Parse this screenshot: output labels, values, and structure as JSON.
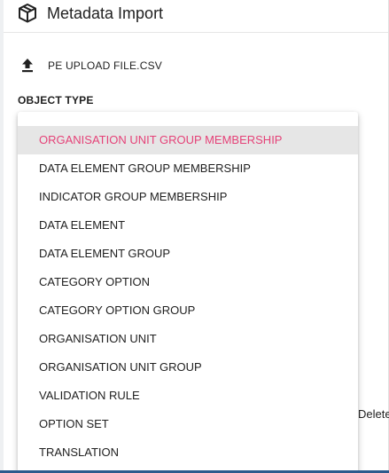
{
  "header": {
    "title": "Metadata Import",
    "icon": "box-import-icon"
  },
  "upload": {
    "label": "PE UPLOAD FILE.CSV",
    "icon": "upload-icon"
  },
  "object_type": {
    "label": "OBJECT TYPE",
    "selected": "ORGANISATION UNIT GROUP MEMBERSHIP",
    "options": [
      "ORGANISATION UNIT GROUP MEMBERSHIP",
      "DATA ELEMENT GROUP MEMBERSHIP",
      "INDICATOR GROUP MEMBERSHIP",
      "DATA ELEMENT",
      "DATA ELEMENT GROUP",
      "CATEGORY OPTION",
      "CATEGORY OPTION GROUP",
      "ORGANISATION UNIT",
      "ORGANISATION UNIT GROUP",
      "VALIDATION RULE",
      "OPTION SET",
      "TRANSLATION"
    ]
  },
  "background_text": {
    "partial": "Delete"
  },
  "colors": {
    "accent": "#e54278",
    "selected_bg": "#e6e6e6",
    "bottom_bar": "#2d5a8c"
  }
}
